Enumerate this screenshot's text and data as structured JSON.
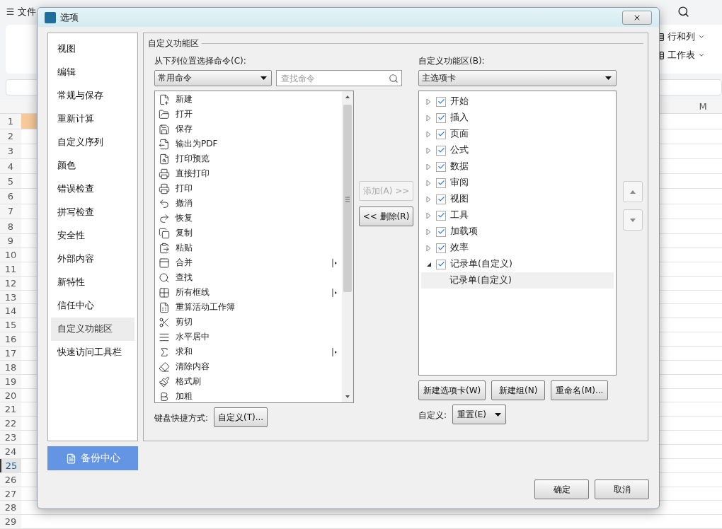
{
  "app": {
    "menu_label": "文件",
    "ribbon": [
      {
        "label": "行和列"
      },
      {
        "label": "工作表"
      }
    ],
    "column_header": "M",
    "rows": [
      {
        "label": "1",
        "selected": false,
        "filled": true
      },
      {
        "label": "2",
        "selected": false,
        "filled": false
      },
      {
        "label": "3",
        "selected": false,
        "filled": false
      },
      {
        "label": "4",
        "selected": false,
        "filled": false
      },
      {
        "label": "5",
        "selected": false,
        "filled": false
      },
      {
        "label": "6",
        "selected": false,
        "filled": false
      },
      {
        "label": "7",
        "selected": false,
        "filled": false
      },
      {
        "label": "8",
        "selected": false,
        "filled": false
      },
      {
        "label": "9",
        "selected": false,
        "filled": false
      },
      {
        "label": "10",
        "selected": false,
        "filled": false
      },
      {
        "label": "11",
        "selected": false,
        "filled": false
      },
      {
        "label": "12",
        "selected": false,
        "filled": false
      },
      {
        "label": "13",
        "selected": false,
        "filled": false
      },
      {
        "label": "14",
        "selected": false,
        "filled": false
      },
      {
        "label": "15",
        "selected": false,
        "filled": false
      },
      {
        "label": "16",
        "selected": false,
        "filled": false
      },
      {
        "label": "17",
        "selected": false,
        "filled": false
      },
      {
        "label": "18",
        "selected": false,
        "filled": false
      },
      {
        "label": "19",
        "selected": false,
        "filled": false
      },
      {
        "label": "20",
        "selected": false,
        "filled": false
      },
      {
        "label": "21",
        "selected": false,
        "filled": false
      },
      {
        "label": "22",
        "selected": false,
        "filled": false
      },
      {
        "label": "23",
        "selected": false,
        "filled": false
      },
      {
        "label": "24",
        "selected": false,
        "filled": false
      },
      {
        "label": "25",
        "selected": true,
        "filled": false
      },
      {
        "label": "26",
        "selected": false,
        "filled": false
      },
      {
        "label": "27",
        "selected": false,
        "filled": false
      },
      {
        "label": "28",
        "selected": false,
        "filled": false
      },
      {
        "label": "29",
        "selected": false,
        "filled": false
      }
    ]
  },
  "dialog": {
    "title": "选项",
    "sidebar": [
      {
        "label": "视图",
        "selected": false
      },
      {
        "label": "编辑",
        "selected": false
      },
      {
        "label": "常规与保存",
        "selected": false
      },
      {
        "label": "重新计算",
        "selected": false
      },
      {
        "label": "自定义序列",
        "selected": false
      },
      {
        "label": "颜色",
        "selected": false
      },
      {
        "label": "错误检查",
        "selected": false
      },
      {
        "label": "拼写检查",
        "selected": false
      },
      {
        "label": "安全性",
        "selected": false
      },
      {
        "label": "外部内容",
        "selected": false
      },
      {
        "label": "新特性",
        "selected": false
      },
      {
        "label": "信任中心",
        "selected": false
      },
      {
        "label": "自定义功能区",
        "selected": true
      },
      {
        "label": "快速访问工具栏",
        "selected": false
      }
    ],
    "backup_button": "备份中心",
    "group_title": "自定义功能区",
    "commands": {
      "label": "从下列位置选择命令(C):",
      "source": "常用命令",
      "search_placeholder": "查找命令",
      "items": [
        {
          "label": "新建",
          "submenu": false
        },
        {
          "label": "打开",
          "submenu": false
        },
        {
          "label": "保存",
          "submenu": false
        },
        {
          "label": "输出为PDF",
          "submenu": false
        },
        {
          "label": "打印预览",
          "submenu": false
        },
        {
          "label": "直接打印",
          "submenu": false
        },
        {
          "label": "打印",
          "submenu": false
        },
        {
          "label": "撤消",
          "submenu": false
        },
        {
          "label": "恢复",
          "submenu": false
        },
        {
          "label": "复制",
          "submenu": false
        },
        {
          "label": "粘贴",
          "submenu": false
        },
        {
          "label": "合并",
          "submenu": true
        },
        {
          "label": "查找",
          "submenu": false
        },
        {
          "label": "所有框线",
          "submenu": true
        },
        {
          "label": "重算活动工作簿",
          "submenu": false
        },
        {
          "label": "剪切",
          "submenu": false
        },
        {
          "label": "水平居中",
          "submenu": false
        },
        {
          "label": "求和",
          "submenu": true
        },
        {
          "label": "清除内容",
          "submenu": false
        },
        {
          "label": "格式刷",
          "submenu": false
        },
        {
          "label": "加粗",
          "submenu": false
        }
      ],
      "shortcut_label": "键盘快捷方式:",
      "shortcut_button": "自定义(T)..."
    },
    "transfer": [
      {
        "label": "添加(A) >>",
        "disabled": true
      },
      {
        "label": "<< 删除(R)",
        "disabled": false
      }
    ],
    "ribbon": {
      "label": "自定义功能区(B):",
      "source": "主选项卡",
      "tree": [
        {
          "label": "开始",
          "checked": true,
          "expanded": false,
          "selected": false
        },
        {
          "label": "插入",
          "checked": true,
          "expanded": false,
          "selected": false
        },
        {
          "label": "页面",
          "checked": true,
          "expanded": false,
          "selected": false
        },
        {
          "label": "公式",
          "checked": true,
          "expanded": false,
          "selected": false
        },
        {
          "label": "数据",
          "checked": true,
          "expanded": false,
          "selected": false
        },
        {
          "label": "审阅",
          "checked": true,
          "expanded": false,
          "selected": false
        },
        {
          "label": "视图",
          "checked": true,
          "expanded": false,
          "selected": false
        },
        {
          "label": "工具",
          "checked": true,
          "expanded": false,
          "selected": false
        },
        {
          "label": "加载项",
          "checked": true,
          "expanded": false,
          "selected": false
        },
        {
          "label": "效率",
          "checked": true,
          "expanded": false,
          "selected": false
        },
        {
          "label": "记录单(自定义)",
          "checked": true,
          "expanded": true,
          "selected": false,
          "children": [
            {
              "label": "记录单(自定义)",
              "selected": true
            }
          ]
        }
      ],
      "buttons": [
        "新建选项卡(W)",
        "新建组(N)",
        "重命名(M)..."
      ],
      "customize_label": "自定义:",
      "reset_button": "重置(E)"
    },
    "footer_buttons": [
      "确定",
      "取消"
    ]
  }
}
